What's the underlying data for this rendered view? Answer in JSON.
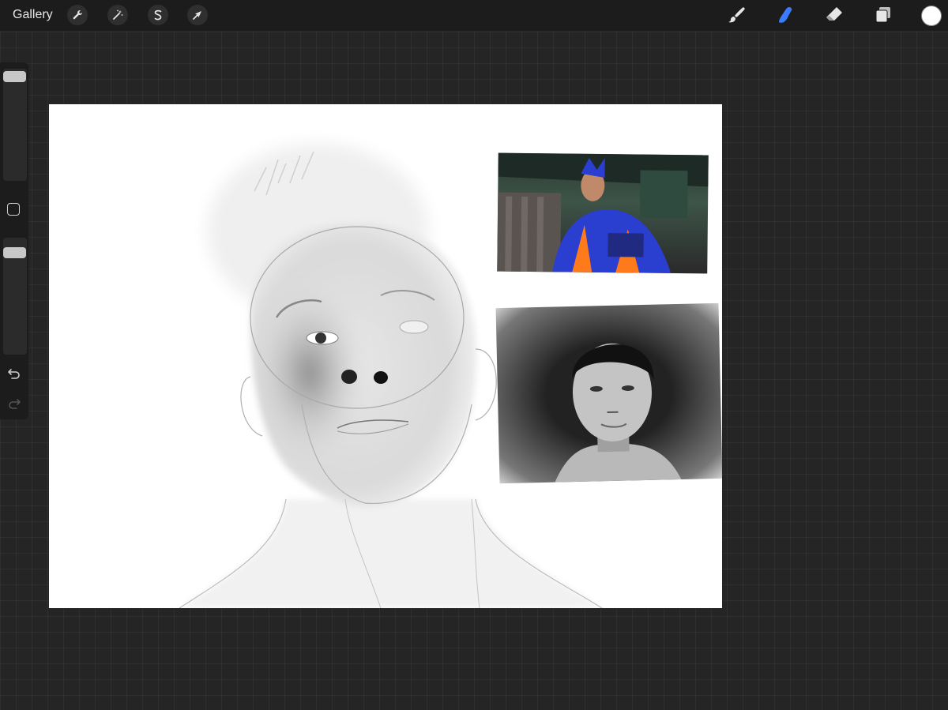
{
  "topbar": {
    "gallery_label": "Gallery",
    "left_tools": [
      {
        "name": "actions",
        "icon": "wrench-icon"
      },
      {
        "name": "adjustments",
        "icon": "magic-wand-icon"
      },
      {
        "name": "selection",
        "icon": "selection-s-icon"
      },
      {
        "name": "transform",
        "icon": "arrow-cursor-icon"
      }
    ],
    "right_tools": [
      {
        "name": "brush",
        "icon": "brush-icon",
        "active": false
      },
      {
        "name": "smudge",
        "icon": "smudge-finger-icon",
        "active": true
      },
      {
        "name": "eraser",
        "icon": "eraser-icon",
        "active": false
      },
      {
        "name": "layers",
        "icon": "layers-icon",
        "active": false
      }
    ],
    "current_color": "#ffffff",
    "active_tool_color": "#3a7bff"
  },
  "sidebar": {
    "size_slider_level": 0.95,
    "opacity_slider_level": 0.95,
    "undo_icon": "undo-icon",
    "redo_icon": "redo-icon"
  },
  "canvas": {
    "background": "#ffffff",
    "reference_images": [
      {
        "name": "reference-game-character",
        "description_icon": "photo-icon"
      },
      {
        "name": "reference-bw-portrait",
        "description_icon": "photo-icon"
      }
    ]
  }
}
